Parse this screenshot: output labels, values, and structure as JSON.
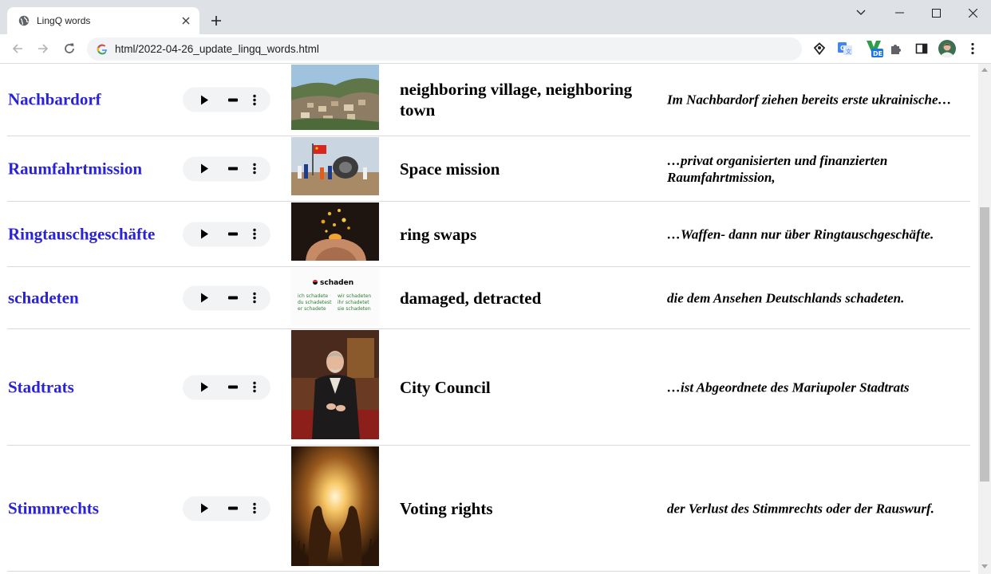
{
  "browser": {
    "tab_title": "LingQ words",
    "url": "html/2022-04-26_update_lingq_words.html",
    "extensions": [
      "location-pin-icon",
      "google-translate-icon",
      "language-de-icon",
      "puzzle-icon",
      "sidepanel-icon",
      "avatar"
    ],
    "extension_badge": "DE"
  },
  "words": [
    {
      "word": "Nachbardorf",
      "translation": "neighboring village, neighboring town",
      "example": "Im Nachbardorf ziehen bereits erste ukrainische…",
      "image": "village-photo"
    },
    {
      "word": "Raumfahrtmission",
      "translation": "Space mission",
      "example": "…privat organisierten und finanzierten Raumfahrtmission,",
      "image": "space-capsule-photo"
    },
    {
      "word": "Ringtauschgeschäfte",
      "translation": "ring swaps",
      "example": "…Waffen- dann nur über Ringtauschgeschäfte.",
      "image": "hands-phone-photo"
    },
    {
      "word": "schadeten",
      "translation": "damaged, detracted",
      "example": "die dem Ansehen Deutschlands schadeten.",
      "image": "conjugation-table",
      "image_text": {
        "title": "schaden",
        "left": [
          "ich schadete",
          "du schadetest",
          "er schadete"
        ],
        "right": [
          "wir schadeten",
          "ihr schadetet",
          "sie schadeten"
        ]
      }
    },
    {
      "word": "Stadtrats",
      "translation": "City Council",
      "example": "…ist Abgeordnete des Mariupoler Stadtrats",
      "image": "portrait-painting"
    },
    {
      "word": "Stimmrechts",
      "translation": "Voting rights",
      "example": "der Verlust des Stimmrechts oder der Rauswurf.",
      "image": "hands-sunset-photo"
    }
  ],
  "colors": {
    "word_link": "#2a22d6",
    "tab_strip": "#dee1e6",
    "omnibox": "#f1f3f4",
    "divider": "#d9d9d9"
  }
}
